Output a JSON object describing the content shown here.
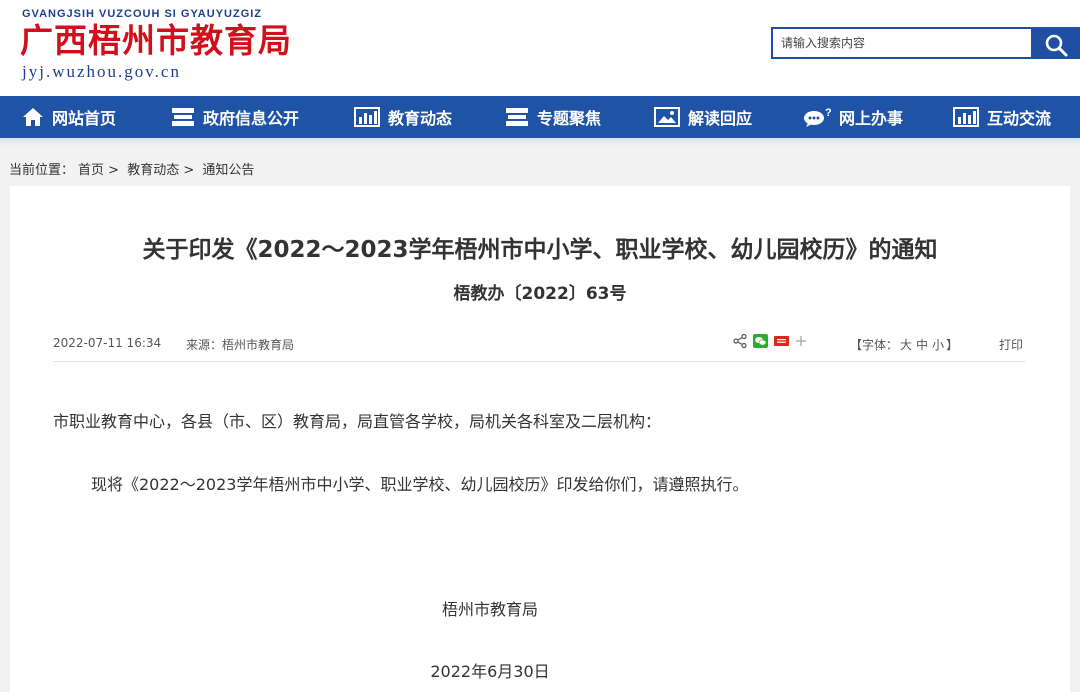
{
  "header": {
    "logo_pinyin": "GVANGJSIH VUZCOUH SI GYAUYUZGIZ",
    "logo_title": "广西梧州市教育局",
    "logo_url": "jyj.wuzhou.gov.cn",
    "search_placeholder": "请输入搜索内容",
    "brand_blue": "#1f53a6",
    "brand_red": "#d0111b"
  },
  "nav": {
    "items": [
      {
        "label": "网站首页",
        "icon": "home-icon"
      },
      {
        "label": "政府信息公开",
        "icon": "doc-stack-icon"
      },
      {
        "label": "教育动态",
        "icon": "bar-chart-icon"
      },
      {
        "label": "专题聚焦",
        "icon": "doc-stack-icon"
      },
      {
        "label": "解读回应",
        "icon": "picture-icon"
      },
      {
        "label": "网上办事",
        "icon": "chat-bubble-icon"
      },
      {
        "label": "互动交流",
        "icon": "bar-chart-icon"
      }
    ]
  },
  "breadcrumb": {
    "prefix": "当前位置：",
    "items": [
      "首页",
      "教育动态",
      "通知公告"
    ],
    "separator": ">"
  },
  "article": {
    "title": "关于印发《2022～2023学年梧州市中小学、职业学校、幼儿园校历》的通知",
    "doc_number": "梧教办〔2022〕63号",
    "date": "2022-07-11 16:34",
    "source": "来源：梧州市教育局",
    "fontsize_label_open": "【字体：",
    "fontsize_large": "大",
    "fontsize_medium": "中",
    "fontsize_small": "小",
    "fontsize_label_close": "】",
    "print_label": "打印",
    "salutation": "市职业教育中心，各县（市、区）教育局，局直管各学校，局机关各科室及二层机构：",
    "paragraph": "现将《2022～2023学年梧州市中小学、职业学校、幼儿园校历》印发给你们，请遵照执行。",
    "signature": "梧州市教育局",
    "signature_date": "2022年6月30日"
  }
}
